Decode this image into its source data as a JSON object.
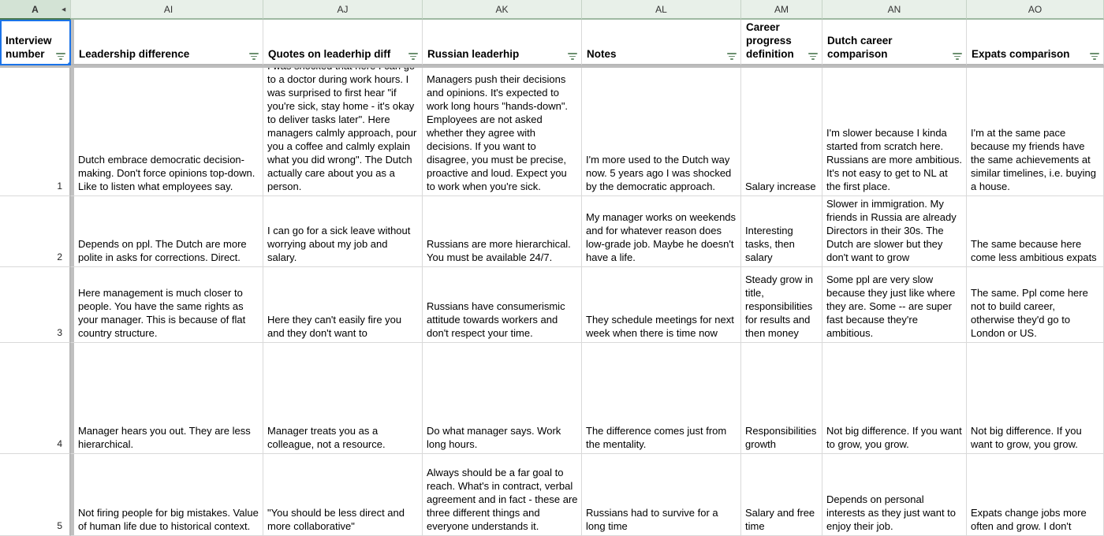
{
  "spreadsheet": {
    "column_letters": [
      "A",
      "AI",
      "AJ",
      "AK",
      "AL",
      "AM",
      "AN",
      "AO"
    ],
    "collapse_arrow": "◂",
    "row_numbers": [
      "1",
      "2",
      "3",
      "4",
      "5"
    ],
    "headers": [
      "Interview number",
      "Leadership difference",
      "Quotes on leaderhip diff",
      "Russian leaderhip",
      "Notes",
      "Career progress definition",
      "Dutch career comparison",
      "Expats comparison"
    ],
    "accent_selection_color": "#1a73e8",
    "header_fill_color": "#e8f0e9",
    "filter_icon_color": "#6b8f6f",
    "rows": [
      {
        "number": "1",
        "leadership_difference": "Dutch embrace democratic decision-making. Don't force opinions top-down. Like to listen what employees say.",
        "quotes_on_leadership_diff": "I was shocked that here I can go to a doctor during work hours. I was surprised to first hear \"if you're sick, stay home - it's okay to deliver tasks later\". Here managers calmly approach, pour you a coffee and calmly explain what you did wrong\". The Dutch actually care about you as a person.",
        "russian_leadership": "Managers push their decisions and opinions. It's expected to work long hours \"hands-down\". Employees are not asked whether they agree with decisions. If you want to disagree, you must be precise, proactive and loud. Expect you to work when you're sick.",
        "notes": "I'm more used to the Dutch way now. 5 years ago I was shocked by the democratic approach.",
        "career_progress_definition": "Salary increase",
        "dutch_career_comparison": "I'm slower because I kinda started from scratch here. Russians are more ambitious. It's not easy to get to NL at the first place.",
        "expats_comparison": "I'm at the same pace because my friends have the same achievements at similar timelines, i.e. buying a house."
      },
      {
        "number": "2",
        "leadership_difference": "Depends on ppl. The Dutch are more polite in asks for corrections. Direct.",
        "quotes_on_leadership_diff": "I can go for a sick leave without worrying about my job and salary.",
        "russian_leadership": "Russians are more hierarchical. You must be available 24/7.",
        "notes": "My manager works on weekends and for whatever reason does low-grade job. Maybe he doesn't have a life.",
        "career_progress_definition": "Interesting tasks, then salary",
        "dutch_career_comparison": "Slower in immigration. My friends in Russia are already Directors in their 30s. The Dutch are slower but they don't want to grow",
        "expats_comparison": "The same because here come less ambitious expats"
      },
      {
        "number": "3",
        "leadership_difference": "Here management is much closer to people. You have the same rights as your manager. This is because of flat country structure.",
        "quotes_on_leadership_diff": "Here they can't easily fire you and they don't want to",
        "russian_leadership": "Russians have consumerismic attitude towards workers and don't respect your time.",
        "notes": "They schedule meetings for next week when there is time now",
        "career_progress_definition": "Steady grow in title, responsibilities for results and then money",
        "dutch_career_comparison": "Some ppl are very slow because they just like where they are. Some -- are super fast because they're ambitious.",
        "expats_comparison": "The same. Ppl come here not to build career, otherwise they'd go to London or US."
      },
      {
        "number": "4",
        "leadership_difference": "Manager hears you out. They are less hierarchical.",
        "quotes_on_leadership_diff": "Manager treats you as a colleague, not a resource.",
        "russian_leadership": "Do what manager says. Work long hours.",
        "notes": "The difference comes just from the mentality.",
        "career_progress_definition": "Responsibilities growth",
        "dutch_career_comparison": "Not big difference. If you want to grow, you grow.",
        "expats_comparison": "Not big difference. If you want to grow, you grow."
      },
      {
        "number": "5",
        "leadership_difference": "Not firing people for big mistakes. Value of human life due to historical context.",
        "quotes_on_leadership_diff": "\"You should be less direct and more collaborative\"",
        "russian_leadership": "Always should be a far goal to reach. What's in contract, verbal agreement and in fact - these are three different things and everyone understands it.",
        "notes": "Russians had to survive for a long time",
        "career_progress_definition": "Salary and free time",
        "dutch_career_comparison": "Depends on personal interests as they just want to enjoy their job.",
        "expats_comparison": "Expats change jobs more often and grow. I don't"
      }
    ]
  }
}
